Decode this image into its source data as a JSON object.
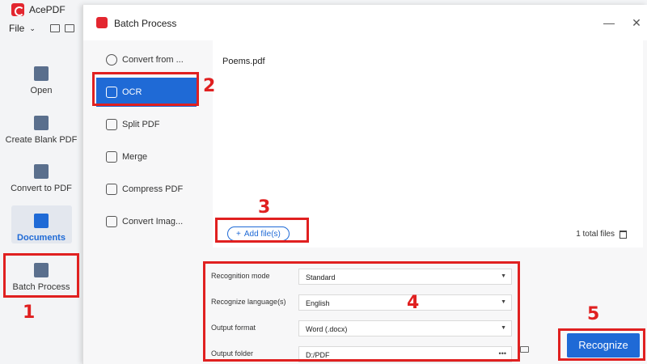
{
  "app": {
    "title": "AcePDF",
    "file_menu": "File"
  },
  "sidebar": {
    "items": [
      {
        "label": "Open"
      },
      {
        "label": "Create Blank PDF"
      },
      {
        "label": "Convert to PDF"
      },
      {
        "label": "Documents"
      },
      {
        "label": "Batch Process"
      }
    ]
  },
  "dialog": {
    "title": "Batch Process",
    "menu": [
      {
        "label": "Convert from ..."
      },
      {
        "label": "OCR",
        "icon_text": "OCR"
      },
      {
        "label": "Split PDF"
      },
      {
        "label": "Merge"
      },
      {
        "label": "Compress PDF"
      },
      {
        "label": "Convert Imag..."
      }
    ],
    "files": [
      "Poems.pdf"
    ],
    "add_files_label": "Add file(s)",
    "add_files_plus": "+",
    "total_files": "1 total files",
    "settings": [
      {
        "label": "Recognition mode",
        "value": "Standard"
      },
      {
        "label": "Recognize language(s)",
        "value": "English"
      },
      {
        "label": "Output format",
        "value": "Word (.docx)"
      },
      {
        "label": "Output folder",
        "value": "D:/PDF"
      }
    ],
    "output_folder_more": "•••",
    "dropdown_arrow": "▼",
    "recognize_label": "Recognize",
    "close_glyph": "✕"
  },
  "annotations": {
    "n1": "1",
    "n2": "2",
    "n3": "3",
    "n4": "4",
    "n5": "5"
  },
  "colors": {
    "accent": "#1f6ad6",
    "annotation": "#e02020",
    "brand": "#e3262f"
  }
}
